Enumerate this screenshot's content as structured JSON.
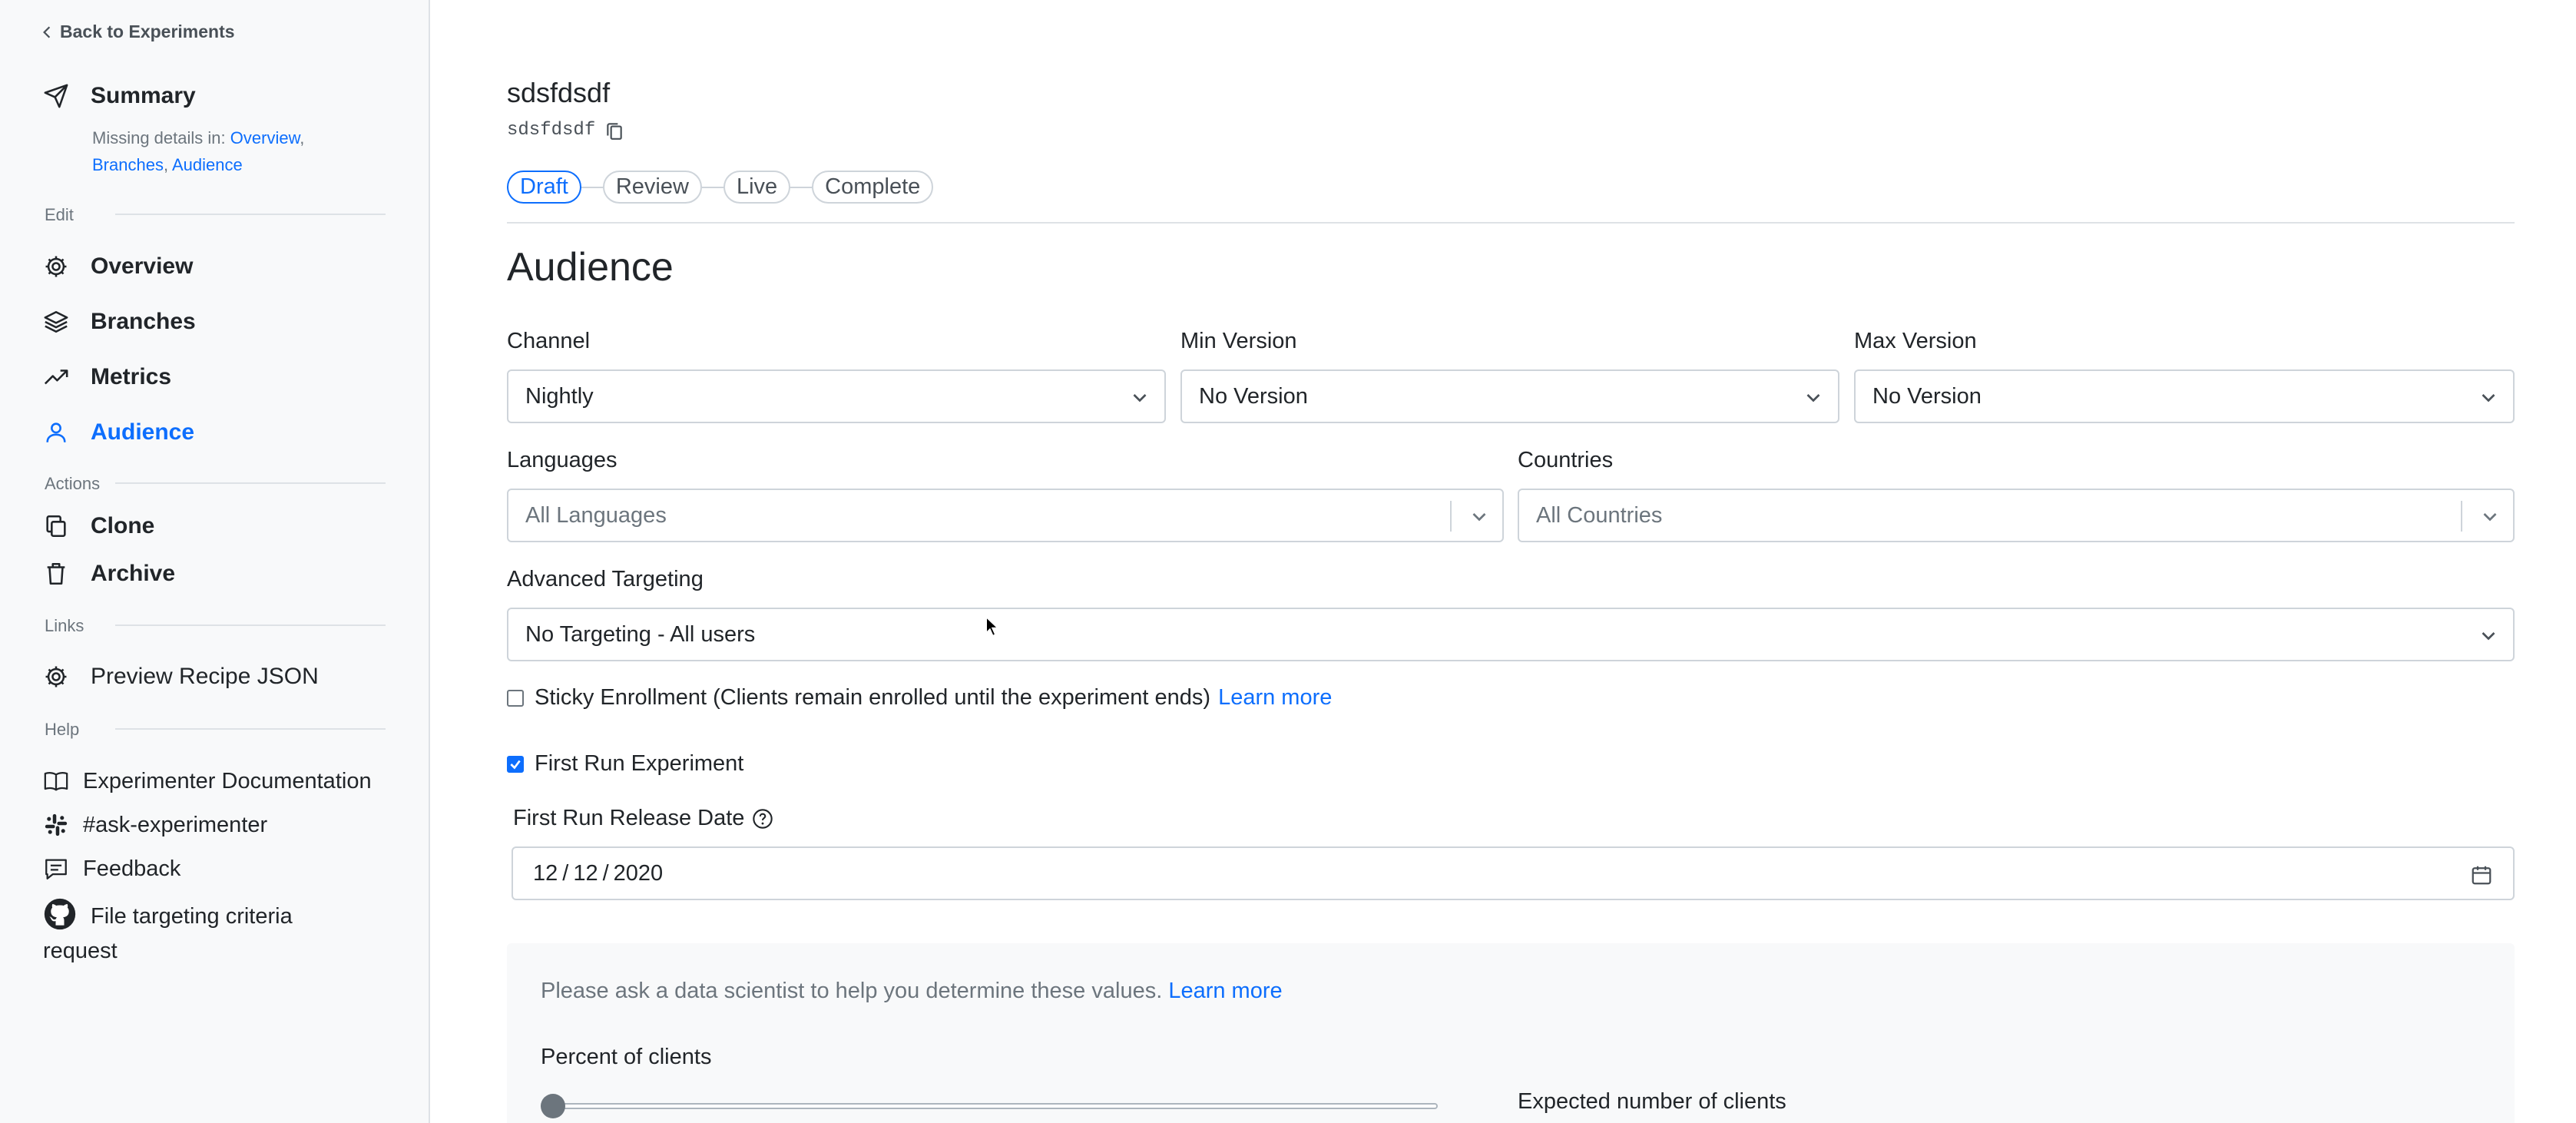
{
  "sidebar": {
    "back_label": "Back to Experiments",
    "summary": {
      "label": "Summary",
      "missing_prefix": "Missing details in:",
      "missing_links": [
        "Overview",
        "Branches",
        "Audience"
      ]
    },
    "edit_label": "Edit",
    "edit_items": [
      {
        "label": "Overview",
        "icon": "gear-icon"
      },
      {
        "label": "Branches",
        "icon": "layers-icon"
      },
      {
        "label": "Metrics",
        "icon": "trend-icon"
      },
      {
        "label": "Audience",
        "icon": "person-icon",
        "active": true
      }
    ],
    "actions_label": "Actions",
    "action_items": [
      {
        "label": "Clone",
        "icon": "copy-icon"
      },
      {
        "label": "Archive",
        "icon": "trash-icon"
      }
    ],
    "links_label": "Links",
    "link_items": [
      {
        "label": "Preview Recipe JSON",
        "icon": "gear-icon"
      }
    ],
    "help_label": "Help",
    "help_items": [
      {
        "label": "Experimenter Documentation",
        "icon": "book-icon"
      },
      {
        "label": "#ask-experimenter",
        "icon": "slack-icon"
      },
      {
        "label": "Feedback",
        "icon": "chat-icon"
      },
      {
        "label": "File targeting criteria request",
        "icon": "github-icon"
      }
    ]
  },
  "header": {
    "title": "sdsfdsdf",
    "slug": "sdsfdsdf",
    "steps": [
      "Draft",
      "Review",
      "Live",
      "Complete"
    ],
    "current_step": "Draft"
  },
  "main": {
    "heading": "Audience",
    "channel": {
      "label": "Channel",
      "value": "Nightly"
    },
    "min_version": {
      "label": "Min Version",
      "value": "No Version"
    },
    "max_version": {
      "label": "Max Version",
      "value": "No Version"
    },
    "languages": {
      "label": "Languages",
      "placeholder": "All Languages"
    },
    "countries": {
      "label": "Countries",
      "placeholder": "All Countries"
    },
    "advanced_targeting": {
      "label": "Advanced Targeting",
      "value": "No Targeting - All users"
    },
    "sticky_enrollment": {
      "label": "Sticky Enrollment (Clients remain enrolled until the experiment ends)",
      "link": "Learn more",
      "checked": false
    },
    "first_run": {
      "label": "First Run Experiment",
      "checked": true
    },
    "first_run_date": {
      "label": "First Run Release Date",
      "month": "12",
      "day": "12",
      "year": "2020"
    },
    "info": {
      "text": "Please ask a data scientist to help you determine these values.",
      "link": "Learn more"
    },
    "percent_clients": {
      "label": "Percent of clients",
      "value": 0
    },
    "expected_clients": {
      "label": "Expected number of clients"
    }
  },
  "colors": {
    "accent": "#0d6efd",
    "sidebar_bg": "#f8f9fa",
    "border": "#ced4da"
  }
}
